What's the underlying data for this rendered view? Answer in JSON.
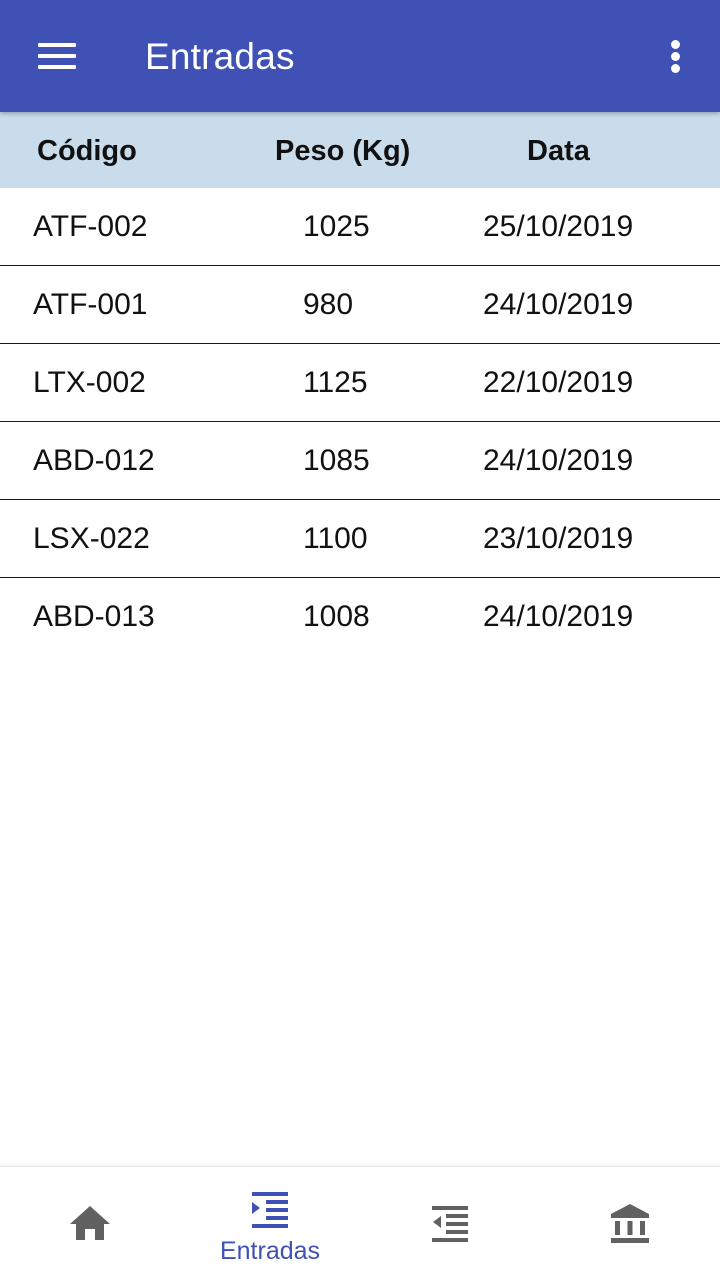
{
  "appbar": {
    "title": "Entradas",
    "menu_icon": "menu-icon",
    "overflow_icon": "more-vert-icon",
    "background": "#3f51b5"
  },
  "table": {
    "header_background": "#c9dcec",
    "columns": [
      "Código",
      "Peso (Kg)",
      "Data"
    ],
    "rows": [
      [
        "ATF-002",
        "1025",
        "25/10/2019"
      ],
      [
        "ATF-001",
        "980",
        "24/10/2019"
      ],
      [
        "LTX-002",
        "1125",
        "22/10/2019"
      ],
      [
        "ABD-012",
        "1085",
        "24/10/2019"
      ],
      [
        "LSX-022",
        "1100",
        "23/10/2019"
      ],
      [
        "ABD-013",
        "1008",
        "24/10/2019"
      ]
    ]
  },
  "bottom_nav": {
    "active_color": "#3f51b5",
    "inactive_color": "#616161",
    "items": [
      {
        "icon": "home-icon",
        "label": ""
      },
      {
        "icon": "format-indent-increase-icon",
        "label": "Entradas",
        "active": true
      },
      {
        "icon": "format-indent-decrease-icon",
        "label": ""
      },
      {
        "icon": "bank-icon",
        "label": ""
      }
    ]
  }
}
